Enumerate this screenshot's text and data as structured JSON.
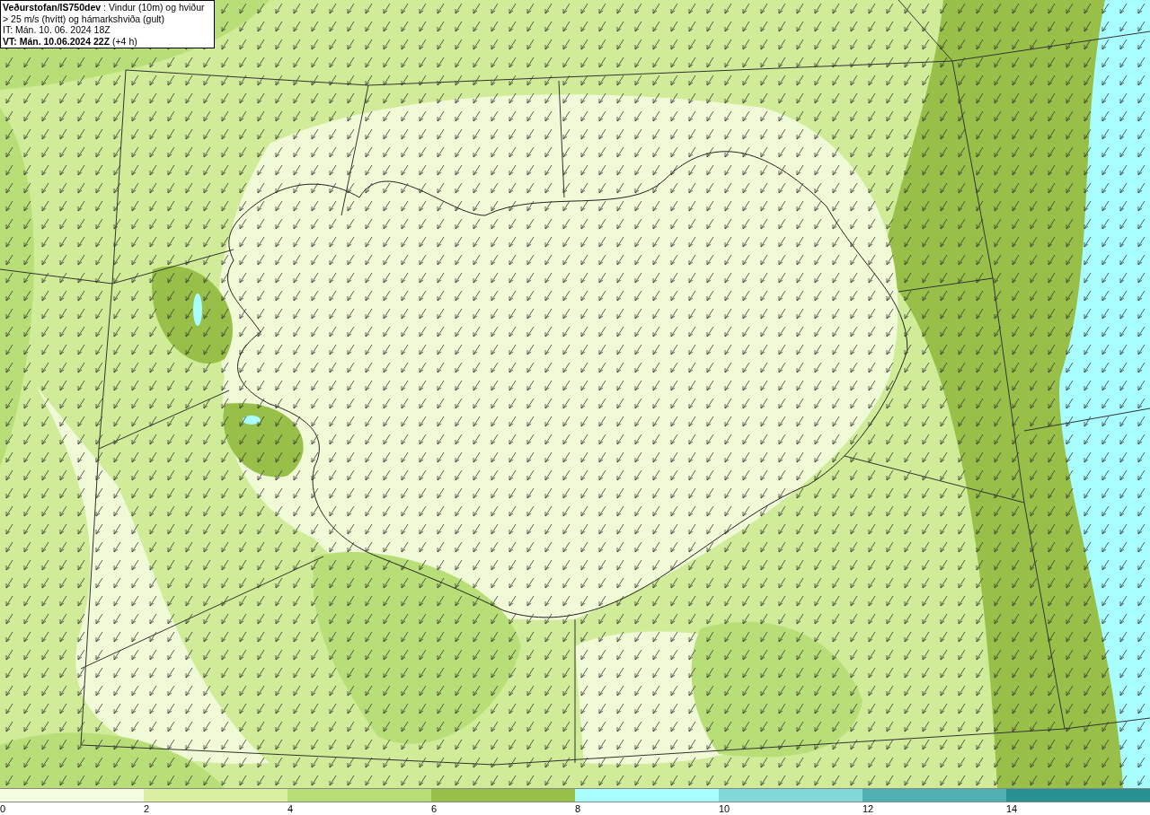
{
  "title_box": {
    "heading": "**Veðurstofan/IS750dev** : Vindur (10m) og hviður > 25 m/s (hvítt) og hámarkshviða (gult)",
    "issue_time": "IT: Mán. 10. 06. 2024 18Z",
    "valid_time": "**VT: Mán. 10.06.2024 22Z** (+4 h)"
  },
  "legend": {
    "bins": [
      {
        "color": "#f5fde0"
      },
      {
        "color": "#d8f0a0"
      },
      {
        "color": "#b8de78"
      },
      {
        "color": "#98c048"
      },
      {
        "color": "#a8feff"
      },
      {
        "color": "#80d8d8"
      },
      {
        "color": "#50b0b0"
      },
      {
        "color": "#289090"
      }
    ],
    "ticks": [
      "0",
      "2",
      "4",
      "6",
      "8",
      "10",
      "12",
      "14"
    ]
  }
}
